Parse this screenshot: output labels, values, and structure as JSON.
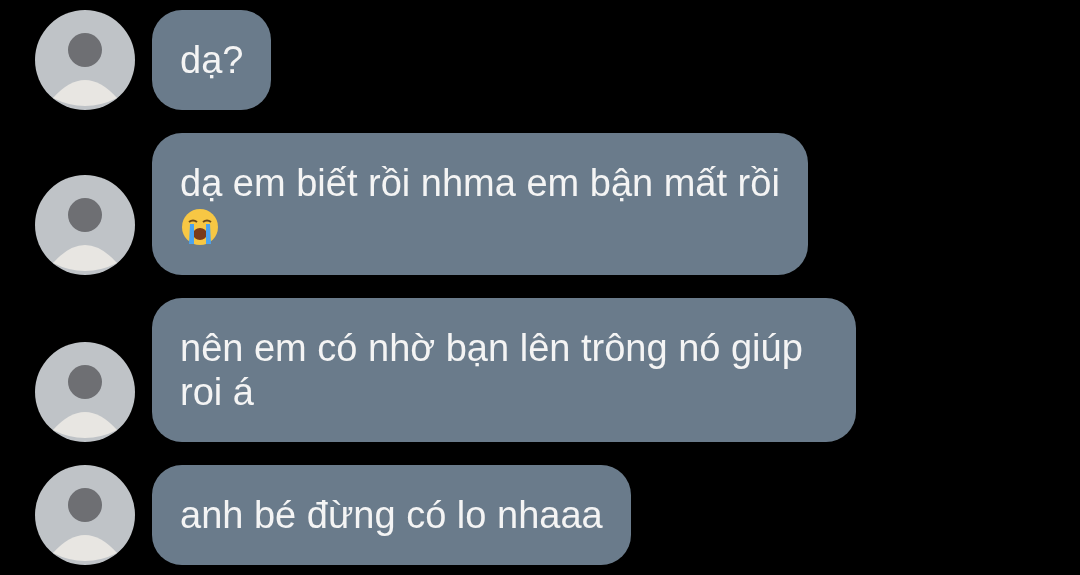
{
  "messages": [
    {
      "text": "dạ?"
    },
    {
      "text": "dạ em biết rồi nhma em bận mất rồi",
      "crying_emoji": true
    },
    {
      "text": "nên em có nhờ bạn lên trông nó giúp roi á"
    },
    {
      "text": "anh bé đừng có lo nhaaa"
    }
  ]
}
